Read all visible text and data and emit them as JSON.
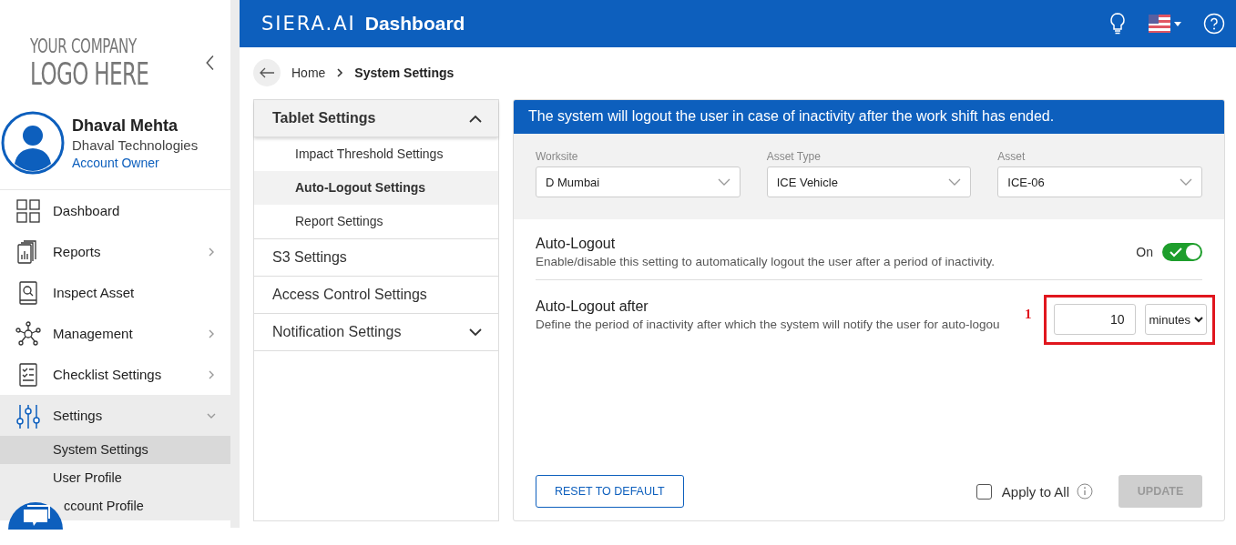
{
  "logo": {
    "line_1": "YOUR COMPANY",
    "line_2": "LOGO HERE"
  },
  "user": {
    "name": "Dhaval Mehta",
    "company": "Dhaval Technologies",
    "role": "Account Owner"
  },
  "sidebar": {
    "items": [
      {
        "label": "Dashboard",
        "kind": "link",
        "selected": false
      },
      {
        "label": "Reports",
        "kind": "group",
        "expanded": false,
        "selected": false
      },
      {
        "label": "Inspect Asset",
        "kind": "link",
        "selected": false
      },
      {
        "label": "Management",
        "kind": "group",
        "expanded": false,
        "selected": false
      },
      {
        "label": "Checklist Settings",
        "kind": "group",
        "expanded": false,
        "selected": false
      },
      {
        "label": "Settings",
        "kind": "group",
        "expanded": true,
        "selected": true,
        "children": [
          {
            "label": "System Settings",
            "selected": true
          },
          {
            "label": "User Profile",
            "selected": false
          },
          {
            "label": "ccount Profile",
            "selected": false
          }
        ]
      }
    ]
  },
  "header": {
    "brand": "SIERA.AI",
    "title": "Dashboard"
  },
  "breadcrumb": {
    "items": [
      "Home",
      "System Settings"
    ]
  },
  "settings_menu": {
    "groups": [
      {
        "label": "Tablet Settings",
        "kind": "group",
        "expanded": true,
        "children": [
          {
            "label": "Impact Threshold Settings",
            "selected": false
          },
          {
            "label": "Auto-Logout Settings",
            "selected": true
          },
          {
            "label": "Report Settings",
            "selected": false
          }
        ]
      },
      {
        "label": "S3 Settings",
        "kind": "link"
      },
      {
        "label": "Access Control Settings",
        "kind": "link"
      },
      {
        "label": "Notification Settings",
        "kind": "group",
        "expanded": false
      }
    ]
  },
  "panel": {
    "banner": "The system will logout the user in case of inactivity after the work shift has ended.",
    "filters": [
      {
        "label": "Worksite",
        "value": "D Mumbai"
      },
      {
        "label": "Asset Type",
        "value": "ICE Vehicle"
      },
      {
        "label": "Asset",
        "value": "ICE-06"
      }
    ],
    "auto_logout": {
      "title": "Auto-Logout",
      "description": "Enable/disable this setting to automatically logout the user after a period of inactivity.",
      "state_label": "On",
      "on": true
    },
    "auto_logout_after": {
      "title": "Auto-Logout after",
      "description": "Define the period of inactivity after which the system will notify the user for auto-logou",
      "value": "10",
      "unit": "minutes",
      "annotation": "1"
    },
    "reset_button": "RESET TO DEFAULT",
    "apply_all": {
      "label": "Apply to All",
      "checked": false
    },
    "update_button": {
      "label": "UPDATE",
      "disabled": true
    }
  }
}
